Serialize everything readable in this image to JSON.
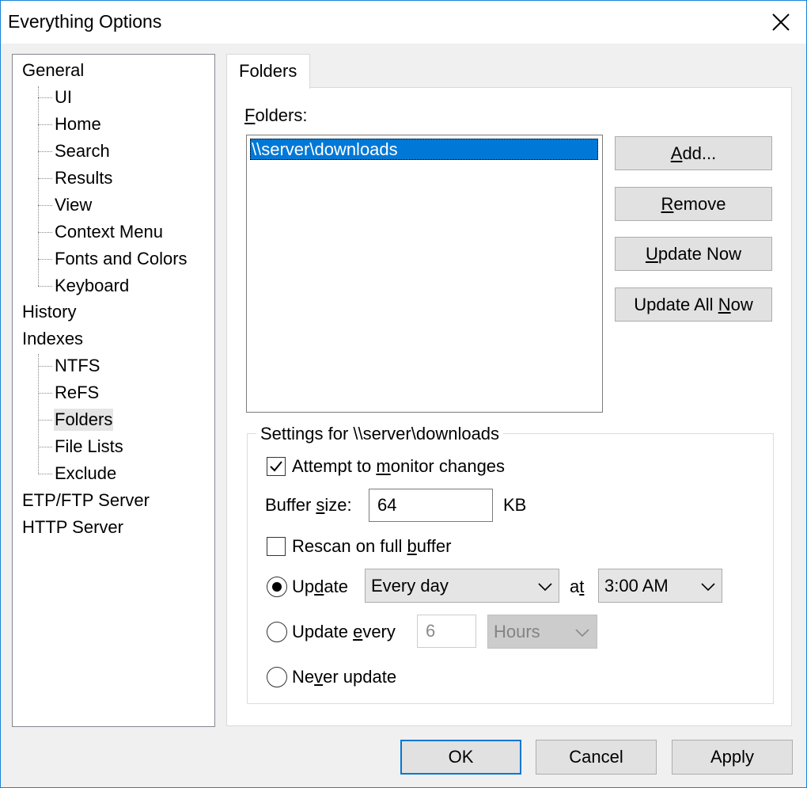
{
  "window": {
    "title": "Everything Options"
  },
  "tree": {
    "general": {
      "label": "General",
      "children": [
        "UI",
        "Home",
        "Search",
        "Results",
        "View",
        "Context Menu",
        "Fonts and Colors",
        "Keyboard"
      ]
    },
    "history": {
      "label": "History"
    },
    "indexes": {
      "label": "Indexes",
      "children": [
        "NTFS",
        "ReFS",
        "Folders",
        "File Lists",
        "Exclude"
      ],
      "selected": "Folders"
    },
    "etp": {
      "label": "ETP/FTP Server"
    },
    "http": {
      "label": "HTTP Server"
    }
  },
  "tab": {
    "label": "Folders"
  },
  "folders": {
    "label_first": "F",
    "label_rest": "olders:",
    "items": [
      "\\\\server\\downloads"
    ],
    "selected_index": 0
  },
  "buttons": {
    "add": {
      "u": "A",
      "rest": "dd..."
    },
    "remove": {
      "u": "R",
      "rest": "emove"
    },
    "update_now": {
      "u": "U",
      "rest": "pdate Now"
    },
    "update_all_now": {
      "pre": "Update All ",
      "u": "N",
      "rest": "ow"
    }
  },
  "settings": {
    "title": "Settings for \\\\server\\downloads",
    "monitor": {
      "pre": "Attempt to ",
      "u": "m",
      "rest": "onitor changes",
      "checked": true
    },
    "buffer": {
      "pre": "Buffer ",
      "u": "s",
      "rest": "ize:",
      "value": "64",
      "unit": "KB"
    },
    "rescan": {
      "pre": "Rescan on full ",
      "u": "b",
      "rest": "uffer",
      "checked": false
    },
    "update_radio": {
      "pre": "Up",
      "u": "d",
      "rest": "ate",
      "selected": true
    },
    "update_frequency": "Every day",
    "at": {
      "pre": "a",
      "u": "t",
      "rest": ""
    },
    "update_time": "3:00 AM",
    "update_every_radio": {
      "pre": "Update ",
      "u": "e",
      "rest": "very",
      "selected": false
    },
    "update_every_value": "6",
    "update_every_unit": "Hours",
    "never_radio": {
      "pre": "Ne",
      "u": "v",
      "rest": "er update",
      "selected": false
    }
  },
  "footer": {
    "ok": "OK",
    "cancel": "Cancel",
    "apply": "Apply"
  },
  "colors": {
    "selection": "#0078d7",
    "button_face": "#e1e1e1",
    "border_accent": "#1883d7"
  }
}
